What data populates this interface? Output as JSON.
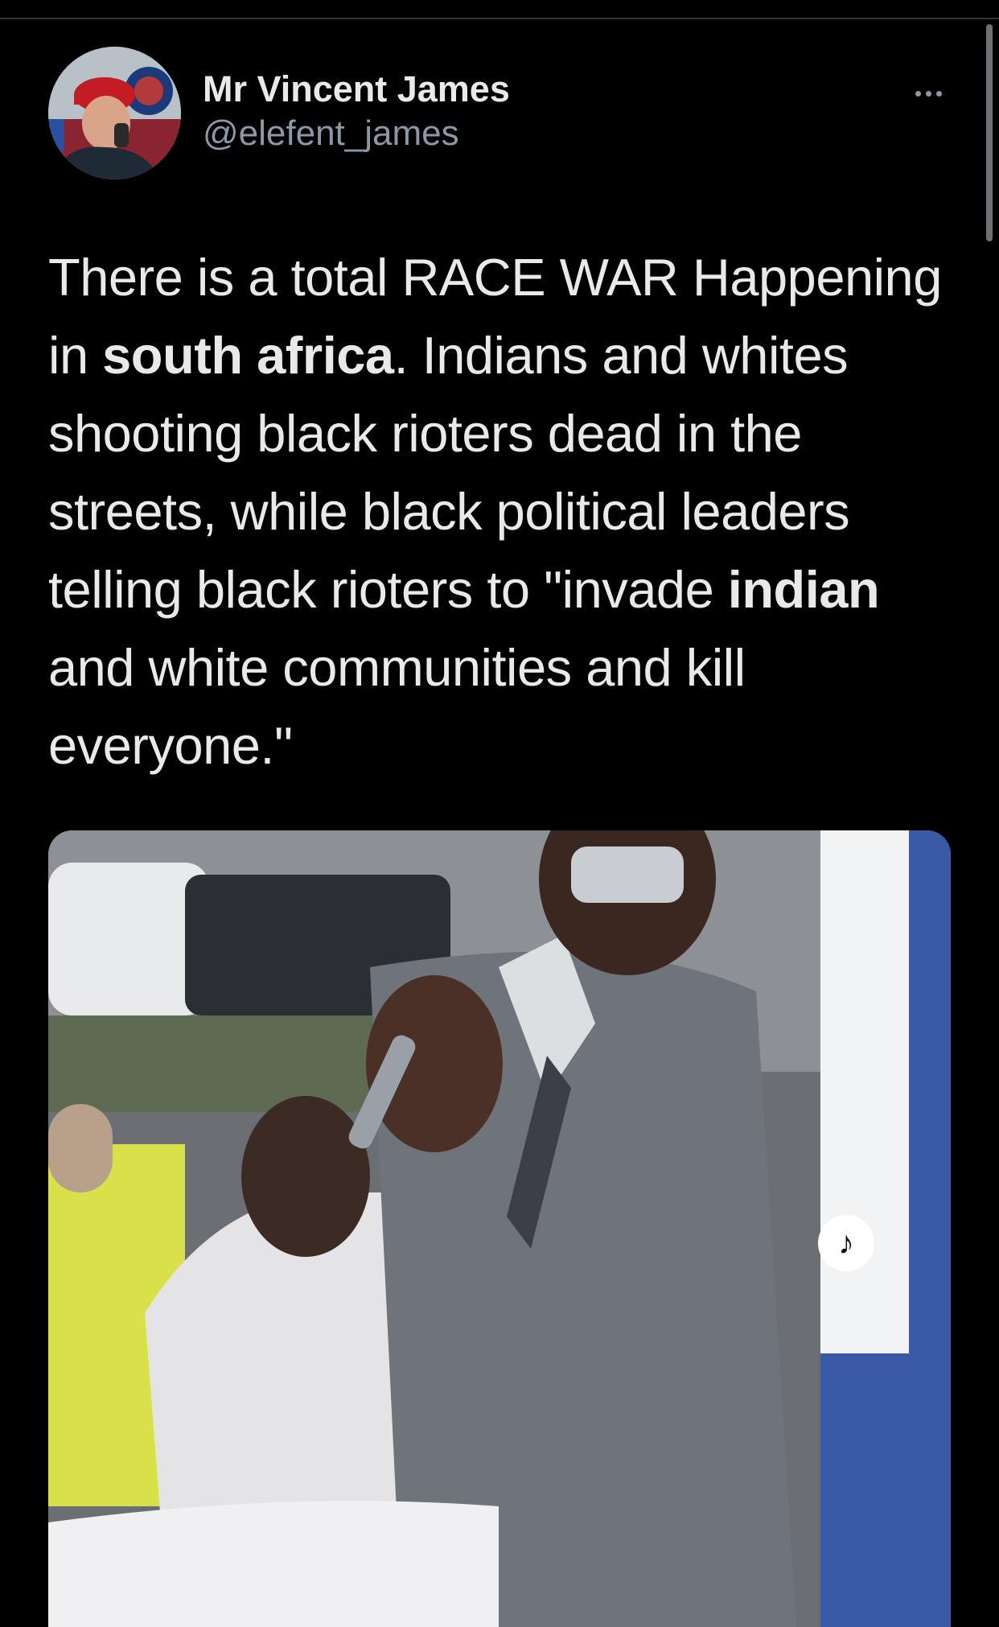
{
  "author": {
    "display_name": "Mr Vincent James",
    "handle": "@elefent_james"
  },
  "tweet": {
    "segments": [
      {
        "text": "There is a total RACE WAR Happening in ",
        "bold": false
      },
      {
        "text": "south africa",
        "bold": true
      },
      {
        "text": ".  Indians and whites shooting black rioters dead in the streets, while black political leaders telling black rioters to \"invade ",
        "bold": false
      },
      {
        "text": "indian",
        "bold": true
      },
      {
        "text": " and white communities and kill everyone.\"",
        "bold": false
      }
    ]
  },
  "media": {
    "type": "video",
    "audio_indicator": "speaker-icon"
  },
  "colors": {
    "background": "#000000",
    "text_primary": "#e7e9ea",
    "text_secondary": "#8b98a5"
  }
}
